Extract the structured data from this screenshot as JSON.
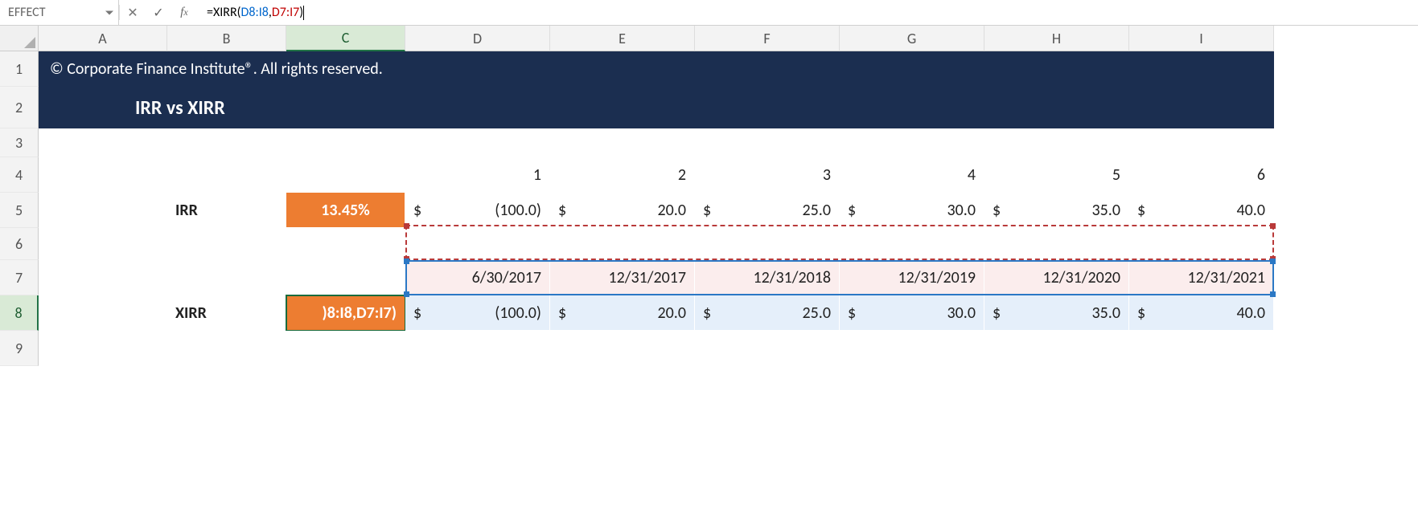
{
  "name_box": "EFFECT",
  "formula": {
    "prefix": "=XIRR(",
    "arg1": "D8:I8",
    "comma": ",",
    "arg2": "D7:I7",
    "suffix": ")"
  },
  "columns": [
    "A",
    "B",
    "C",
    "D",
    "E",
    "F",
    "G",
    "H",
    "I"
  ],
  "active_col": "C",
  "active_row": "8",
  "banner_copyright": "© Corporate Finance Institute®. All rights reserved.",
  "banner_title": "IRR vs XIRR",
  "periods": [
    "1",
    "2",
    "3",
    "4",
    "5",
    "6"
  ],
  "irr_label": "IRR",
  "irr_value": "13.45%",
  "xirr_label": "XIRR",
  "sel_cell_text": ")8:I8,D7:I7)",
  "dates": [
    "6/30/2017",
    "12/31/2017",
    "12/31/2018",
    "12/31/2019",
    "12/31/2020",
    "12/31/2021"
  ],
  "cash_sym": "$",
  "cash_vals": [
    "(100.0)",
    "20.0",
    "25.0",
    "30.0",
    "35.0",
    "40.0"
  ],
  "chart_data": {
    "type": "table",
    "title": "IRR vs XIRR",
    "irr": {
      "periods": [
        1,
        2,
        3,
        4,
        5,
        6
      ],
      "cashflows": [
        -100.0,
        20.0,
        25.0,
        30.0,
        35.0,
        40.0
      ],
      "result_pct": 13.45
    },
    "xirr": {
      "dates": [
        "2017-06-30",
        "2017-12-31",
        "2018-12-31",
        "2019-12-31",
        "2020-12-31",
        "2021-12-31"
      ],
      "cashflows": [
        -100.0,
        20.0,
        25.0,
        30.0,
        35.0,
        40.0
      ],
      "formula": "=XIRR(D8:I8,D7:I7)"
    }
  }
}
